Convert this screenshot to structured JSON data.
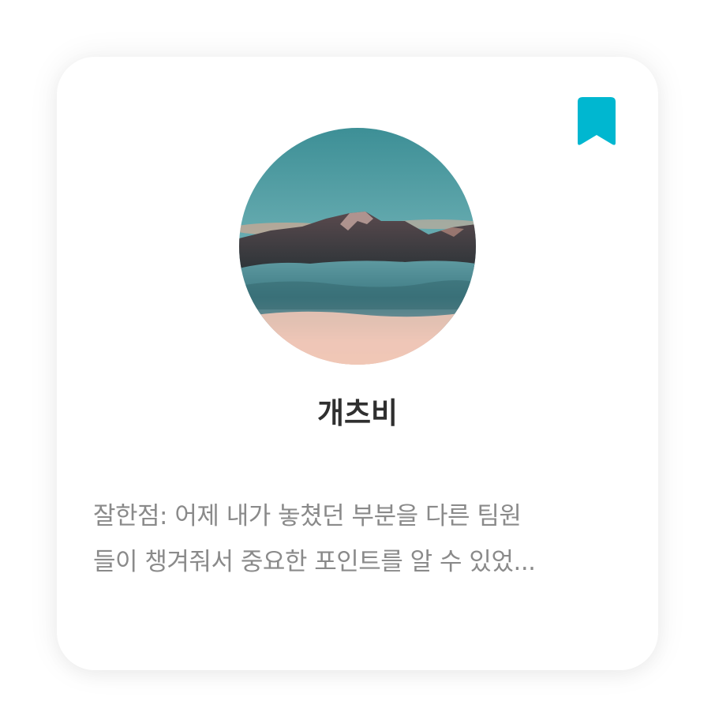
{
  "card": {
    "name": "개츠비",
    "comment_lines": [
      "잘한점: 어제 내가 놓쳤던 부분을 다른 팀원",
      "들이 챙겨줘서 중요한 포인트를 알 수 있었..."
    ],
    "bookmark_icon": "bookmark-icon",
    "avatar_image": "mountain-landscape-avatar"
  },
  "colors": {
    "accent": "#00b7d0",
    "name_text": "#2f2f2f",
    "comment_text": "#8a8a8a"
  }
}
